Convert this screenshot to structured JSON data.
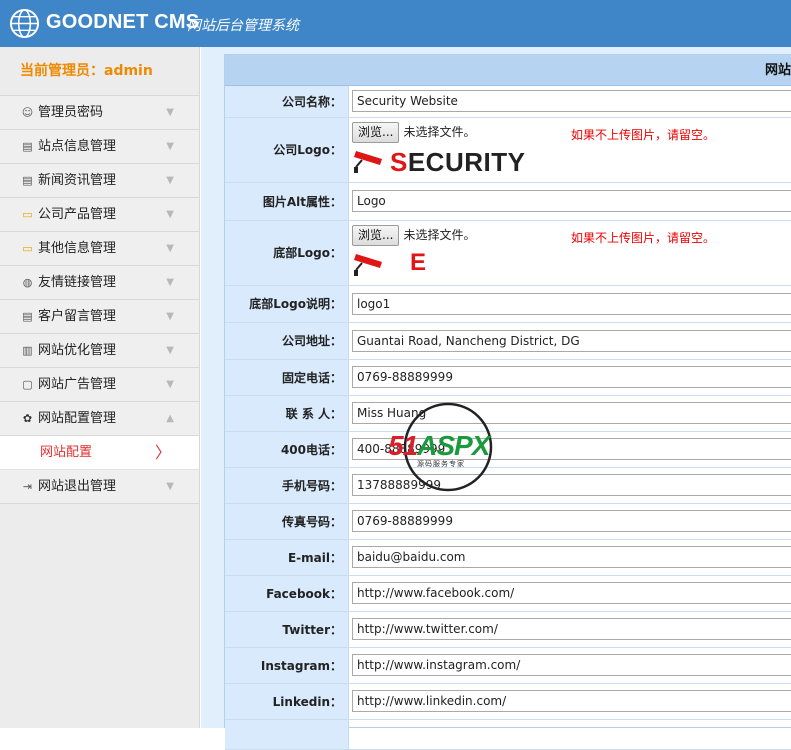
{
  "header": {
    "brand": "GOODNET CMS",
    "subtitle": "网站后台管理系统"
  },
  "sidebar": {
    "admin_label": "当前管理员：admin",
    "items": [
      {
        "label": "管理员密码",
        "icon": "user-icon",
        "glyph": "☺",
        "arrow": "▼"
      },
      {
        "label": "站点信息管理",
        "icon": "document-icon",
        "glyph": "▤",
        "arrow": "▼"
      },
      {
        "label": "新闻资讯管理",
        "icon": "document-icon",
        "glyph": "▤",
        "arrow": "▼"
      },
      {
        "label": "公司产品管理",
        "icon": "folder-icon",
        "glyph": "▭",
        "arrow": "▼"
      },
      {
        "label": "其他信息管理",
        "icon": "folder-icon",
        "glyph": "▭",
        "arrow": "▼"
      },
      {
        "label": "友情链接管理",
        "icon": "globe-icon",
        "glyph": "◍",
        "arrow": "▼"
      },
      {
        "label": "客户留言管理",
        "icon": "list-icon",
        "glyph": "▤",
        "arrow": "▼"
      },
      {
        "label": "网站优化管理",
        "icon": "bar-chart-icon",
        "glyph": "▥",
        "arrow": "▼"
      },
      {
        "label": "网站广告管理",
        "icon": "monitor-icon",
        "glyph": "▢",
        "arrow": "▼"
      },
      {
        "label": "网站配置管理",
        "icon": "gear-icon",
        "glyph": "✿",
        "arrow": "▲"
      }
    ],
    "submenu": {
      "label": "网站配置",
      "chevron": "〉"
    },
    "logout": {
      "label": "网站退出管理",
      "icon": "logout-icon",
      "glyph": "⇥",
      "arrow": "▼"
    }
  },
  "panel": {
    "title": "网站",
    "browse_label": "浏览...",
    "no_file_label": "未选择文件。",
    "upload_hint": "如果不上传图片，请留空。",
    "logo_text": {
      "red": "S",
      "rest": "ECURITY"
    },
    "footer_logo_text": "E",
    "rows": [
      {
        "label": "公司名称：",
        "value": "Security Website"
      },
      {
        "label": "图片Alt属性：",
        "value": "Logo"
      },
      {
        "label": "底部Logo说明：",
        "value": "logo1"
      },
      {
        "label": "公司地址：",
        "value": "Guantai Road, Nancheng District, DG"
      },
      {
        "label": "固定电话：",
        "value": "0769-88889999"
      },
      {
        "label": "联 系 人：",
        "value": "Miss Huang"
      },
      {
        "label": "400电话：",
        "value": "400-88889999"
      },
      {
        "label": "手机号码：",
        "value": "13788889999"
      },
      {
        "label": "传真号码：",
        "value": "0769-88889999"
      },
      {
        "label": "E-mail：",
        "value": "baidu@baidu.com"
      },
      {
        "label": "Facebook：",
        "value": "http://www.facebook.com/"
      },
      {
        "label": "Twitter：",
        "value": "http://www.twitter.com/"
      },
      {
        "label": "Instagram：",
        "value": "http://www.instagram.com/"
      },
      {
        "label": "Linkedin：",
        "value": "http://www.linkedin.com/"
      }
    ],
    "logo_label": "公司Logo：",
    "footer_logo_label": "底部Logo："
  },
  "watermark": {
    "red": "51",
    "green": "ASPX",
    "sub": "源码服务专家"
  },
  "colors": {
    "header": "#3f86c8",
    "accent": "#ef8a00",
    "active": "#e12f2f",
    "label_bg": "#d9eafc"
  }
}
